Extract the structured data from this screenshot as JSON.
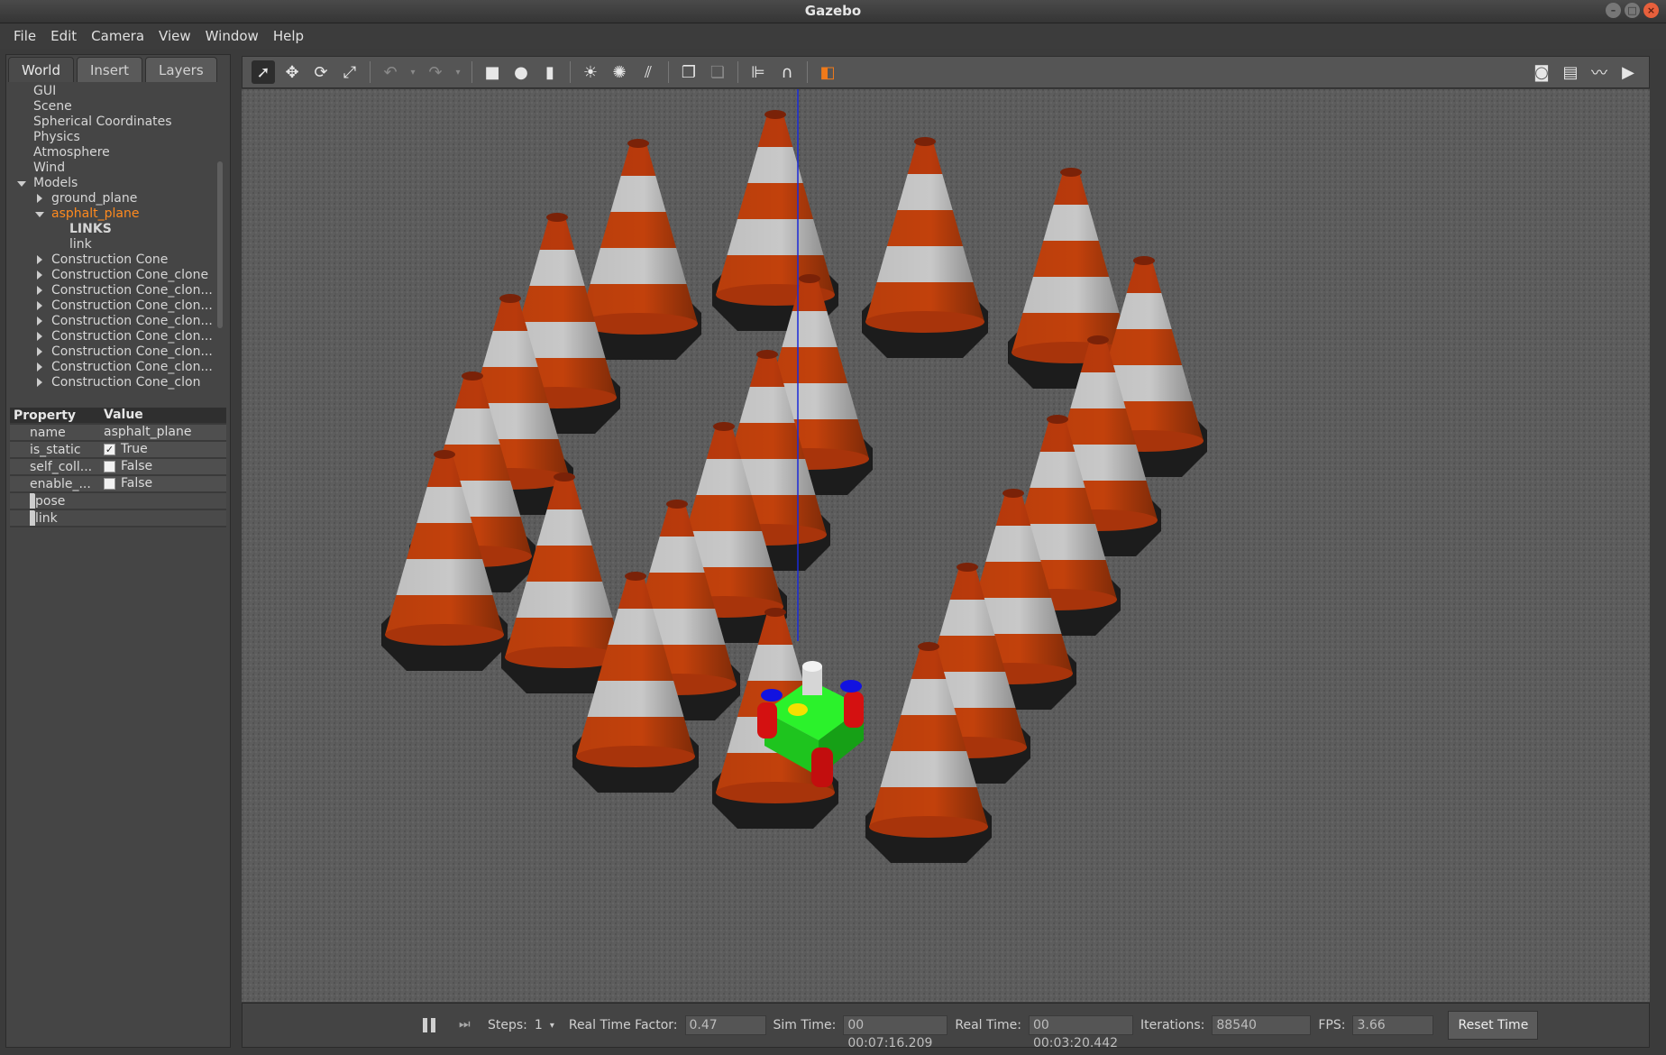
{
  "window": {
    "title": "Gazebo"
  },
  "menu": [
    "File",
    "Edit",
    "Camera",
    "View",
    "Window",
    "Help"
  ],
  "tabs": [
    "World",
    "Insert",
    "Layers"
  ],
  "tree": [
    {
      "label": "GUI",
      "indent": 0,
      "arrow": "none"
    },
    {
      "label": "Scene",
      "indent": 0,
      "arrow": "none"
    },
    {
      "label": "Spherical Coordinates",
      "indent": 0,
      "arrow": "none"
    },
    {
      "label": "Physics",
      "indent": 0,
      "arrow": "none"
    },
    {
      "label": "Atmosphere",
      "indent": 0,
      "arrow": "none"
    },
    {
      "label": "Wind",
      "indent": 0,
      "arrow": "none"
    },
    {
      "label": "Models",
      "indent": 0,
      "arrow": "down"
    },
    {
      "label": "ground_plane",
      "indent": 1,
      "arrow": "right"
    },
    {
      "label": "asphalt_plane",
      "indent": 1,
      "arrow": "down",
      "selected": true
    },
    {
      "label": "LINKS",
      "indent": 2,
      "arrow": "none",
      "bold": true
    },
    {
      "label": "link",
      "indent": 2,
      "arrow": "none"
    },
    {
      "label": "Construction Cone",
      "indent": 1,
      "arrow": "right"
    },
    {
      "label": "Construction Cone_clone",
      "indent": 1,
      "arrow": "right"
    },
    {
      "label": "Construction Cone_clon...",
      "indent": 1,
      "arrow": "right"
    },
    {
      "label": "Construction Cone_clon...",
      "indent": 1,
      "arrow": "right"
    },
    {
      "label": "Construction Cone_clon...",
      "indent": 1,
      "arrow": "right"
    },
    {
      "label": "Construction Cone_clon...",
      "indent": 1,
      "arrow": "right"
    },
    {
      "label": "Construction Cone_clon...",
      "indent": 1,
      "arrow": "right"
    },
    {
      "label": "Construction Cone_clon...",
      "indent": 1,
      "arrow": "right"
    },
    {
      "label": "Construction Cone_clon",
      "indent": 1,
      "arrow": "right"
    }
  ],
  "properties": {
    "header": {
      "key": "Property",
      "value": "Value"
    },
    "rows": [
      {
        "key": "name",
        "value": "asphalt_plane",
        "checkbox": null
      },
      {
        "key": "is_static",
        "value": "True",
        "checkbox": true
      },
      {
        "key": "self_coll...",
        "value": "False",
        "checkbox": false
      },
      {
        "key": "enable_...",
        "value": "False",
        "checkbox": false
      }
    ],
    "groups": [
      "pose",
      "link"
    ]
  },
  "toolbar": {
    "left": [
      "select-icon",
      "translate-icon",
      "rotate-icon",
      "scale-icon",
      "sep",
      "undo-icon",
      "undo-dropdown-icon",
      "redo-icon",
      "redo-dropdown-icon",
      "sep",
      "box-icon",
      "sphere-icon",
      "cylinder-icon",
      "sep",
      "point-light-icon",
      "spot-light-icon",
      "directional-light-icon",
      "sep",
      "copy-icon",
      "paste-icon",
      "sep",
      "align-icon",
      "snap-icon",
      "sep",
      "view-angle-icon"
    ],
    "right": [
      "screenshot-icon",
      "log-icon",
      "plot-icon",
      "record-icon"
    ]
  },
  "bottom": {
    "steps_label": "Steps:",
    "steps_value": "1",
    "rtf_label": "Real Time Factor:",
    "rtf_value": "0.47",
    "sim_label": "Sim Time:",
    "sim_value": "00 00:07:16.209",
    "real_label": "Real Time:",
    "real_value": "00 00:03:20.442",
    "iter_label": "Iterations:",
    "iter_value": "88540",
    "fps_label": "FPS:",
    "fps_value": "3.66",
    "reset_label": "Reset Time"
  },
  "colors": {
    "accent_selected": "#ff8a1e",
    "cone_orange": "#c2410c",
    "cone_white": "#c8c8c8",
    "cone_base": "#1c1c1c",
    "robot_body": "#22e022",
    "robot_wheel": "#d41111",
    "axis_line": "#1a2bd8"
  }
}
